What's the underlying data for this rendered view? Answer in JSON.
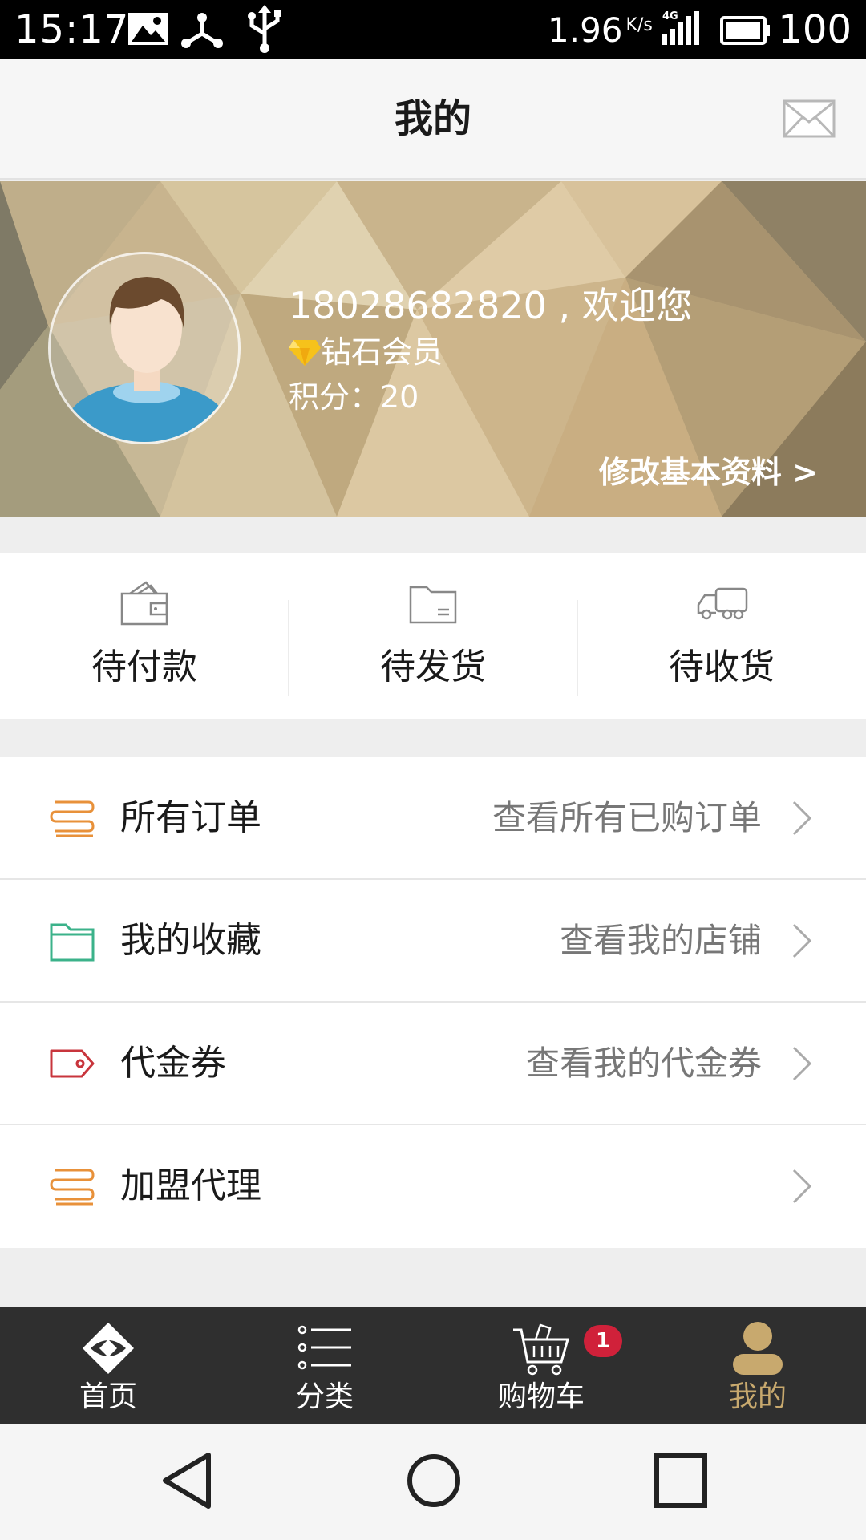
{
  "status_bar": {
    "time": "15:17",
    "speed": "1.96",
    "speed_unit": "K/s",
    "network": "4G",
    "battery": "100"
  },
  "header": {
    "title": "我的"
  },
  "profile": {
    "welcome": "18028682820 , 欢迎您",
    "level": "钻石会员",
    "points": "积分：20",
    "edit_link": "修改基本资料 >"
  },
  "order_status": [
    {
      "label": "待付款",
      "icon": "wallet-icon"
    },
    {
      "label": "待发货",
      "icon": "folder-icon"
    },
    {
      "label": "待收货",
      "icon": "truck-icon"
    }
  ],
  "menu": [
    {
      "label": "所有订单",
      "hint": "查看所有已购订单",
      "icon": "orders-icon",
      "icon_color": "#e8913a"
    },
    {
      "label": "我的收藏",
      "hint": "查看我的店铺",
      "icon": "folder-icon",
      "icon_color": "#3bb28a"
    },
    {
      "label": "代金券",
      "hint": "查看我的代金券",
      "icon": "tag-icon",
      "icon_color": "#c8353c"
    },
    {
      "label": "加盟代理",
      "hint": "",
      "icon": "franchise-icon",
      "icon_color": "#e8913a"
    }
  ],
  "bottom_nav": [
    {
      "label": "首页",
      "icon": "home-icon",
      "active": false
    },
    {
      "label": "分类",
      "icon": "list-icon",
      "active": false
    },
    {
      "label": "购物车",
      "icon": "cart-icon",
      "active": false,
      "badge": "1"
    },
    {
      "label": "我的",
      "icon": "user-icon",
      "active": true
    }
  ],
  "colors": {
    "accent": "#c8a96e",
    "badge": "#d0213a",
    "nav_bg": "#2f2f2f"
  }
}
